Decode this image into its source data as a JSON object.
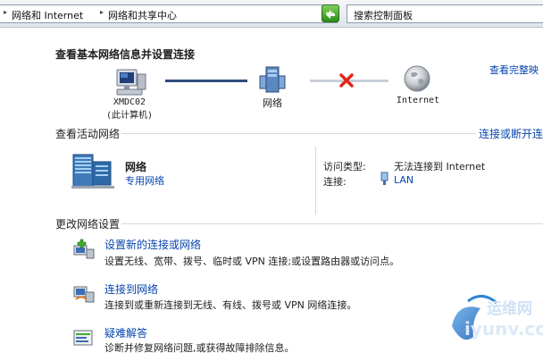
{
  "breadcrumb": {
    "items": [
      "网络和 Internet",
      "网络和共享中心"
    ]
  },
  "search": {
    "placeholder": "搜索控制面板"
  },
  "main": {
    "title": "查看基本网络信息并设置连接",
    "full_map_link": "查看完整映",
    "map": {
      "computer_label": "XMDC02",
      "computer_sub": "(此计算机)",
      "network_label": "网络",
      "internet_label": "Internet"
    },
    "active_networks": {
      "header": "查看活动网络",
      "connect_link": "连接或断开连",
      "network_name": "网络",
      "network_type": "专用网络",
      "access_type_label": "访问类型:",
      "access_type_value": "无法连接到 Internet",
      "connections_label": "连接:",
      "connections_value": "LAN"
    },
    "change_settings": {
      "header": "更改网络设置",
      "tasks": [
        {
          "title": "设置新的连接或网络",
          "desc": "设置无线、宽带、拨号、临时或 VPN 连接;或设置路由器或访问点。"
        },
        {
          "title": "连接到网络",
          "desc": "连接到或重新连接到无线、有线、拨号或 VPN 网络连接。"
        },
        {
          "title": "疑难解答",
          "desc": "诊断并修复网络问题,或获得故障排除信息。"
        }
      ]
    }
  },
  "watermark": {
    "brand": "运维网",
    "url": "iyunv.com"
  },
  "colors": {
    "link": "#0645ad",
    "disconnect": "#e0261b",
    "line_dark": "#2f4a7a",
    "line_light": "#c9cfd8"
  }
}
